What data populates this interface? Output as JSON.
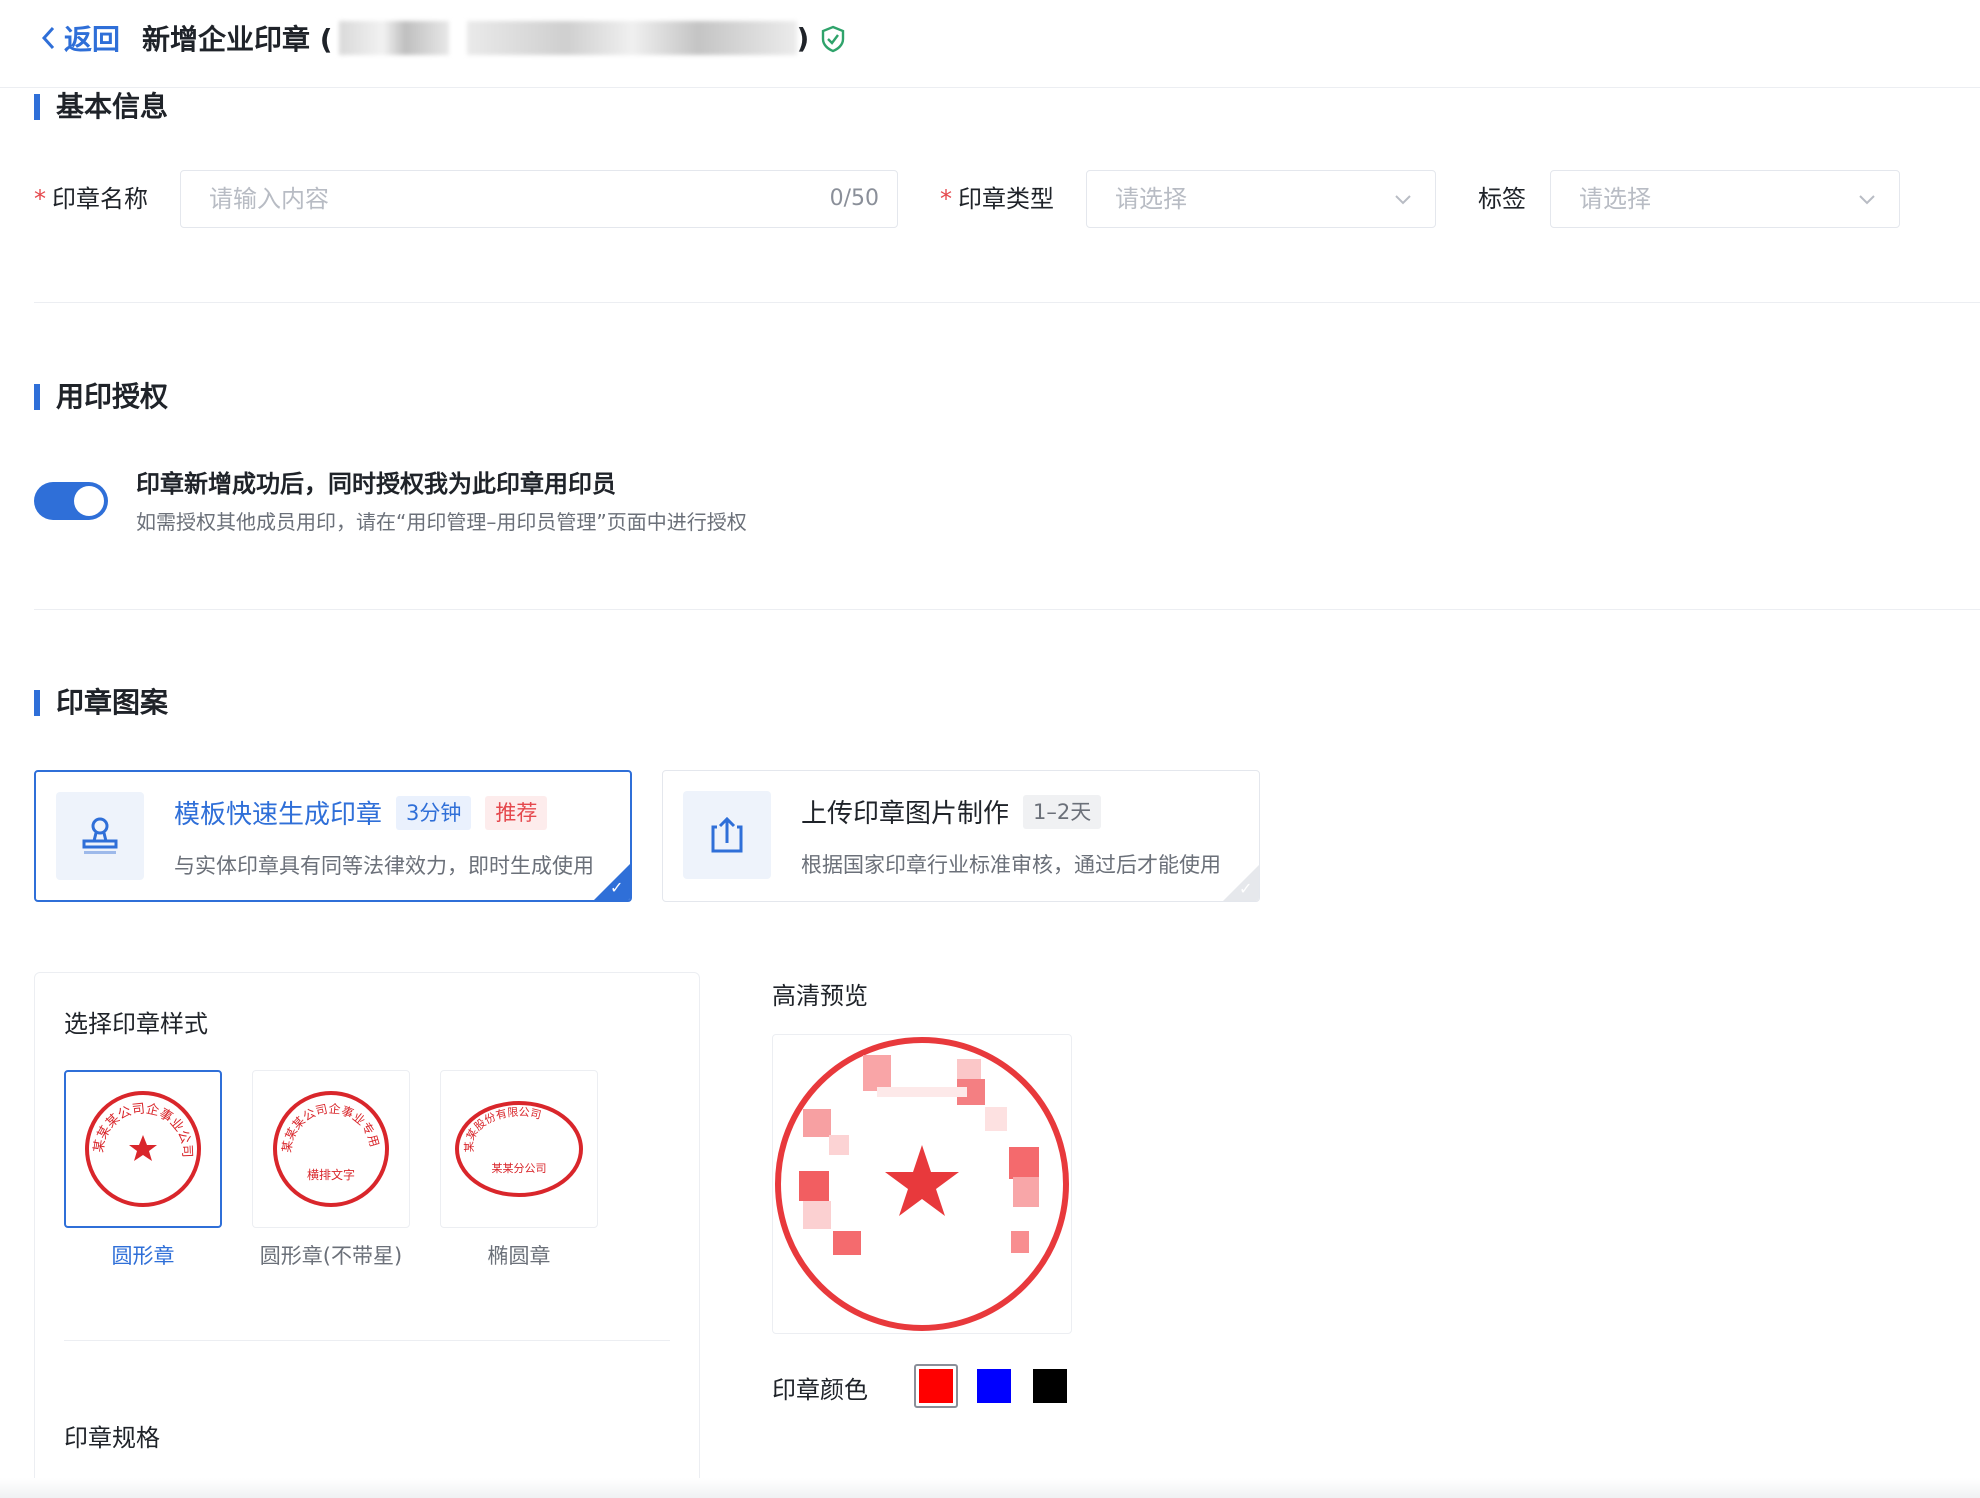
{
  "header": {
    "back_label": "返回",
    "title_prefix": "新增企业印章 (",
    "title_suffix": ")"
  },
  "sections": {
    "basic_info": "基本信息",
    "authorization": "用印授权",
    "pattern": "印章图案"
  },
  "basic_form": {
    "name_label": "印章名称",
    "name_placeholder": "请输入内容",
    "name_count": "0/50",
    "type_label": "印章类型",
    "type_placeholder": "请选择",
    "tag_label": "标签",
    "tag_placeholder": "请选择"
  },
  "authorization": {
    "toggle_on": true,
    "main_text": "印章新增成功后，同时授权我为此印章用印员",
    "sub_text": "如需授权其他成员用印，请在“用印管理–用印员管理”页面中进行授权"
  },
  "modes": [
    {
      "title": "模板快速生成印章",
      "time_tag": "3分钟",
      "rec_tag": "推荐",
      "desc": "与实体印章具有同等法律效力，即时生成使用",
      "selected": true
    },
    {
      "title": "上传印章图片制作",
      "time_tag": "1–2天",
      "desc": "根据国家印章行业标准审核，通过后才能使用",
      "selected": false
    }
  ],
  "style_panel": {
    "title": "选择印章样式",
    "options": [
      {
        "label": "圆形章",
        "selected": true
      },
      {
        "label": "圆形章(不带星)",
        "selected": false
      },
      {
        "label": "椭圆章",
        "selected": false
      }
    ],
    "spec_title": "印章规格",
    "sample_chars_company": "某某某公司企事业公司",
    "sample_chars_special": "某某某公司企事业专用章",
    "sample_horizontal": "横排文字",
    "sample_oval_company": "某某股份有限公司",
    "sample_oval_branch": "某某分公司"
  },
  "preview": {
    "title": "高清预览",
    "color_label": "印章颜色",
    "colors": [
      "#ff0000",
      "#0000ff",
      "#000000"
    ],
    "selected_color": "#ff0000"
  },
  "icons": {
    "back": "chevron-left-icon",
    "verified": "shield-check-icon",
    "stamp": "stamp-icon",
    "upload": "upload-icon",
    "dropdown": "chevron-down-icon"
  }
}
